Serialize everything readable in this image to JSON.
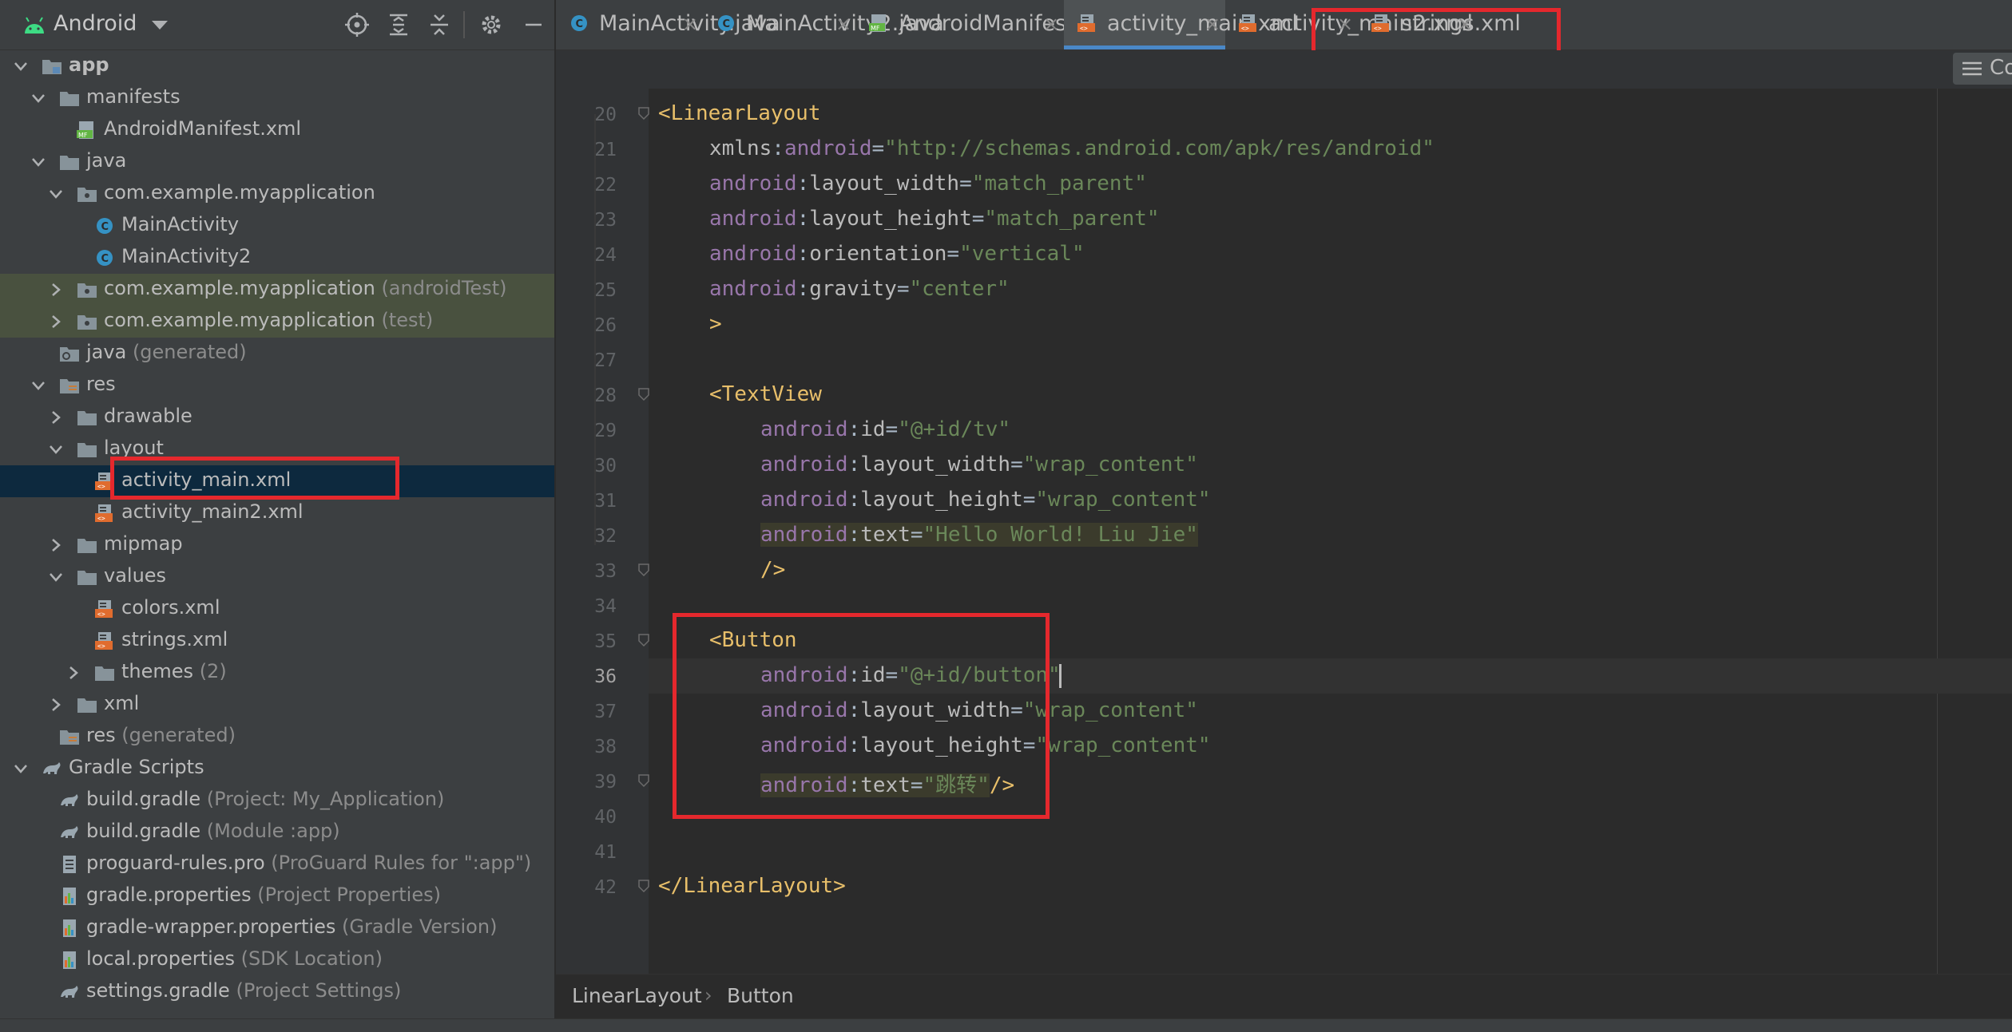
{
  "project_panel": {
    "view_selector": "Android",
    "tree": [
      {
        "label": "app",
        "suffix": "",
        "depth": 0,
        "expanded": true,
        "icon": "module-folder-icon",
        "bold": true
      },
      {
        "label": "manifests",
        "suffix": "",
        "depth": 1,
        "expanded": true,
        "icon": "folder-icon"
      },
      {
        "label": "AndroidManifest.xml",
        "suffix": "",
        "depth": 2,
        "icon": "manifest-file-icon"
      },
      {
        "label": "java",
        "suffix": "",
        "depth": 1,
        "expanded": true,
        "icon": "folder-icon"
      },
      {
        "label": "com.example.myapplication",
        "suffix": "",
        "depth": 2,
        "expanded": true,
        "icon": "package-icon"
      },
      {
        "label": "MainActivity",
        "suffix": "",
        "depth": 3,
        "icon": "class-icon"
      },
      {
        "label": "MainActivity2",
        "suffix": "",
        "depth": 3,
        "icon": "class-icon"
      },
      {
        "label": "com.example.myapplication",
        "suffix": "(androidTest)",
        "depth": 2,
        "expanded": false,
        "icon": "package-icon",
        "highlight": true
      },
      {
        "label": "com.example.myapplication",
        "suffix": "(test)",
        "depth": 2,
        "expanded": false,
        "icon": "package-icon",
        "highlight": true
      },
      {
        "label": "java",
        "suffix": "(generated)",
        "depth": 1,
        "icon": "generated-folder-icon"
      },
      {
        "label": "res",
        "suffix": "",
        "depth": 1,
        "expanded": true,
        "icon": "res-folder-icon"
      },
      {
        "label": "drawable",
        "suffix": "",
        "depth": 2,
        "expanded": false,
        "icon": "folder-icon"
      },
      {
        "label": "layout",
        "suffix": "",
        "depth": 2,
        "expanded": true,
        "icon": "folder-icon"
      },
      {
        "label": "activity_main.xml",
        "suffix": "",
        "depth": 3,
        "icon": "layout-xml-icon",
        "selected": true
      },
      {
        "label": "activity_main2.xml",
        "suffix": "",
        "depth": 3,
        "icon": "layout-xml-icon"
      },
      {
        "label": "mipmap",
        "suffix": "",
        "depth": 2,
        "expanded": false,
        "icon": "folder-icon"
      },
      {
        "label": "values",
        "suffix": "",
        "depth": 2,
        "expanded": true,
        "icon": "folder-icon"
      },
      {
        "label": "colors.xml",
        "suffix": "",
        "depth": 3,
        "icon": "values-xml-icon"
      },
      {
        "label": "strings.xml",
        "suffix": "",
        "depth": 3,
        "icon": "values-xml-icon"
      },
      {
        "label": "themes",
        "suffix": "(2)",
        "depth": 3,
        "expanded": false,
        "icon": "folder-icon"
      },
      {
        "label": "xml",
        "suffix": "",
        "depth": 2,
        "expanded": false,
        "icon": "folder-icon"
      },
      {
        "label": "res",
        "suffix": "(generated)",
        "depth": 1,
        "icon": "res-folder-icon"
      },
      {
        "label": "Gradle Scripts",
        "suffix": "",
        "depth": 0,
        "expanded": true,
        "icon": "gradle-icon"
      },
      {
        "label": "build.gradle",
        "suffix": "(Project: My_Application)",
        "depth": 1,
        "icon": "gradle-icon"
      },
      {
        "label": "build.gradle",
        "suffix": "(Module :app)",
        "depth": 1,
        "icon": "gradle-icon"
      },
      {
        "label": "proguard-rules.pro",
        "suffix": "(ProGuard Rules for \":app\")",
        "depth": 1,
        "icon": "text-file-icon"
      },
      {
        "label": "gradle.properties",
        "suffix": "(Project Properties)",
        "depth": 1,
        "icon": "properties-file-icon"
      },
      {
        "label": "gradle-wrapper.properties",
        "suffix": "(Gradle Version)",
        "depth": 1,
        "icon": "properties-file-icon"
      },
      {
        "label": "local.properties",
        "suffix": "(SDK Location)",
        "depth": 1,
        "icon": "properties-file-icon"
      },
      {
        "label": "settings.gradle",
        "suffix": "(Project Settings)",
        "depth": 1,
        "icon": "gradle-icon"
      }
    ]
  },
  "tabs": [
    {
      "label": "MainActivity.java",
      "icon": "class-icon"
    },
    {
      "label": "MainActivity2.java",
      "icon": "class-icon"
    },
    {
      "label": "AndroidManifest.xml",
      "icon": "manifest-file-icon"
    },
    {
      "label": "activity_main.xml",
      "icon": "layout-xml-icon",
      "active": true
    },
    {
      "label": "activity_main2.xml",
      "icon": "layout-xml-icon"
    },
    {
      "label": "strings.xml",
      "icon": "values-xml-icon"
    }
  ],
  "reader_mode_label": "Co",
  "editor": {
    "lines": [
      {
        "n": "20",
        "indent": 0,
        "tokens": [
          [
            "t",
            "<LinearLayout"
          ]
        ],
        "fold": true
      },
      {
        "n": "21",
        "indent": 1,
        "tokens": [
          [
            "at",
            "xmlns"
          ],
          [
            "eq",
            ":"
          ],
          [
            "ns",
            "android"
          ],
          [
            "eq",
            "="
          ],
          [
            "vl",
            "\"http://schemas.android.com/apk/res/android\""
          ]
        ]
      },
      {
        "n": "22",
        "indent": 1,
        "tokens": [
          [
            "ns",
            "android"
          ],
          [
            "eq",
            ":"
          ],
          [
            "at",
            "layout_width"
          ],
          [
            "eq",
            "="
          ],
          [
            "vl",
            "\"match_parent\""
          ]
        ]
      },
      {
        "n": "23",
        "indent": 1,
        "tokens": [
          [
            "ns",
            "android"
          ],
          [
            "eq",
            ":"
          ],
          [
            "at",
            "layout_height"
          ],
          [
            "eq",
            "="
          ],
          [
            "vl",
            "\"match_parent\""
          ]
        ]
      },
      {
        "n": "24",
        "indent": 1,
        "tokens": [
          [
            "ns",
            "android"
          ],
          [
            "eq",
            ":"
          ],
          [
            "at",
            "orientation"
          ],
          [
            "eq",
            "="
          ],
          [
            "vl",
            "\"vertical\""
          ]
        ]
      },
      {
        "n": "25",
        "indent": 1,
        "tokens": [
          [
            "ns",
            "android"
          ],
          [
            "eq",
            ":"
          ],
          [
            "at",
            "gravity"
          ],
          [
            "eq",
            "="
          ],
          [
            "vl",
            "\"center\""
          ]
        ]
      },
      {
        "n": "26",
        "indent": 1,
        "tokens": [
          [
            "t",
            ">"
          ]
        ]
      },
      {
        "n": "27",
        "indent": 0,
        "tokens": []
      },
      {
        "n": "28",
        "indent": 1,
        "tokens": [
          [
            "t",
            "<TextView"
          ]
        ],
        "fold": true
      },
      {
        "n": "29",
        "indent": 2,
        "tokens": [
          [
            "ns",
            "android"
          ],
          [
            "eq",
            ":"
          ],
          [
            "at",
            "id"
          ],
          [
            "eq",
            "="
          ],
          [
            "vl",
            "\"@+id/tv\""
          ]
        ]
      },
      {
        "n": "30",
        "indent": 2,
        "tokens": [
          [
            "ns",
            "android"
          ],
          [
            "eq",
            ":"
          ],
          [
            "at",
            "layout_width"
          ],
          [
            "eq",
            "="
          ],
          [
            "vl",
            "\"wrap_content\""
          ]
        ]
      },
      {
        "n": "31",
        "indent": 2,
        "tokens": [
          [
            "ns",
            "android"
          ],
          [
            "eq",
            ":"
          ],
          [
            "at",
            "layout_height"
          ],
          [
            "eq",
            "="
          ],
          [
            "vl",
            "\"wrap_content\""
          ]
        ]
      },
      {
        "n": "32",
        "indent": 2,
        "tokens": [
          [
            "ns",
            "android"
          ],
          [
            "eq",
            ":"
          ],
          [
            "at",
            "text"
          ],
          [
            "eq",
            "="
          ],
          [
            "vl",
            "\"Hello World! Liu Jie\""
          ]
        ],
        "hilite": true
      },
      {
        "n": "33",
        "indent": 2,
        "tokens": [
          [
            "t",
            "/>"
          ]
        ],
        "fold": true
      },
      {
        "n": "34",
        "indent": 0,
        "tokens": []
      },
      {
        "n": "35",
        "indent": 1,
        "tokens": [
          [
            "t",
            "<Button"
          ]
        ],
        "fold": true
      },
      {
        "n": "36",
        "indent": 2,
        "tokens": [
          [
            "ns",
            "android"
          ],
          [
            "eq",
            ":"
          ],
          [
            "at",
            "id"
          ],
          [
            "eq",
            "="
          ],
          [
            "vl",
            "\"@+id/button\""
          ]
        ],
        "current": true
      },
      {
        "n": "37",
        "indent": 2,
        "tokens": [
          [
            "ns",
            "android"
          ],
          [
            "eq",
            ":"
          ],
          [
            "at",
            "layout_width"
          ],
          [
            "eq",
            "="
          ],
          [
            "vl",
            "\"wrap_content\""
          ]
        ]
      },
      {
        "n": "38",
        "indent": 2,
        "tokens": [
          [
            "ns",
            "android"
          ],
          [
            "eq",
            ":"
          ],
          [
            "at",
            "layout_height"
          ],
          [
            "eq",
            "="
          ],
          [
            "vl",
            "\"wrap_content\""
          ]
        ]
      },
      {
        "n": "39",
        "indent": 2,
        "tokens": [
          [
            "ns",
            "android"
          ],
          [
            "eq",
            ":"
          ],
          [
            "at",
            "text"
          ],
          [
            "eq",
            "="
          ],
          [
            "vl",
            "\"跳转\""
          ],
          [
            "t",
            "/>"
          ]
        ],
        "hilite": true,
        "fold": true
      },
      {
        "n": "40",
        "indent": 0,
        "tokens": []
      },
      {
        "n": "41",
        "indent": 0,
        "tokens": []
      },
      {
        "n": "42",
        "indent": 0,
        "tokens": [
          [
            "t",
            "</LinearLayout>"
          ]
        ],
        "fold": true
      }
    ]
  },
  "breadcrumb": [
    "LinearLayout",
    "Button"
  ],
  "colors": {
    "annotation_red": "#e5282d",
    "active_tab_underline": "#4a88c7",
    "selection": "#0d293e"
  }
}
